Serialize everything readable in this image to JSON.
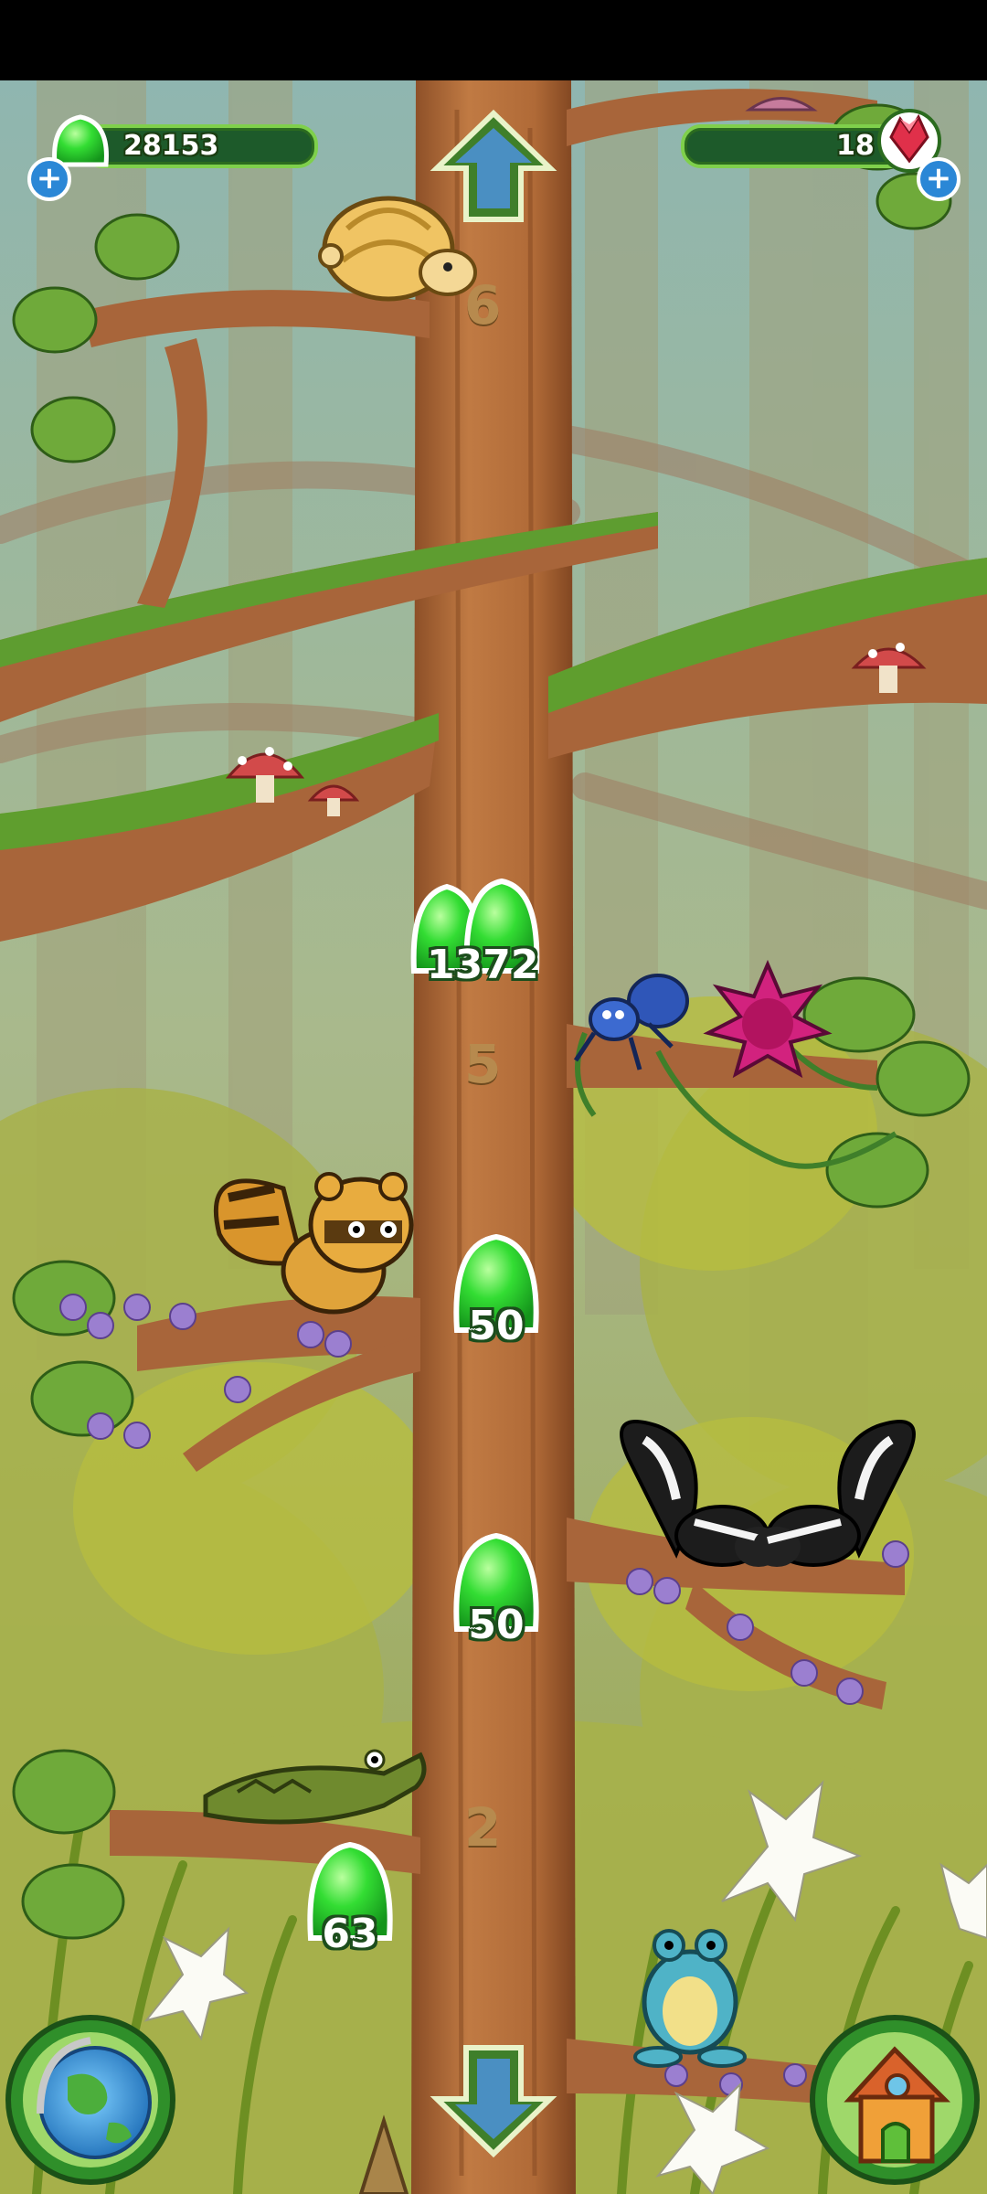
{
  "hud": {
    "coins": "28153",
    "gems": "18",
    "add_coins_label": "+",
    "add_gems_label": "+"
  },
  "floors": {
    "floor6": "6",
    "floor5": "5",
    "floor2": "2"
  },
  "jelly_pickups": [
    {
      "id": "jelly-1372",
      "label": "1372"
    },
    {
      "id": "jelly-50-upper",
      "label": "50"
    },
    {
      "id": "jelly-50-lower",
      "label": "50"
    },
    {
      "id": "jelly-63",
      "label": "63"
    }
  ],
  "colors": {
    "jelly": "#2fd12f",
    "trunk": "#b56f3c",
    "hud_bar": "#1d5a2a",
    "arrow": "#4a8fc2"
  },
  "icons": {
    "up": "up-arrow-icon",
    "down": "down-arrow-icon",
    "map": "globe-icon",
    "home": "house-icon"
  }
}
